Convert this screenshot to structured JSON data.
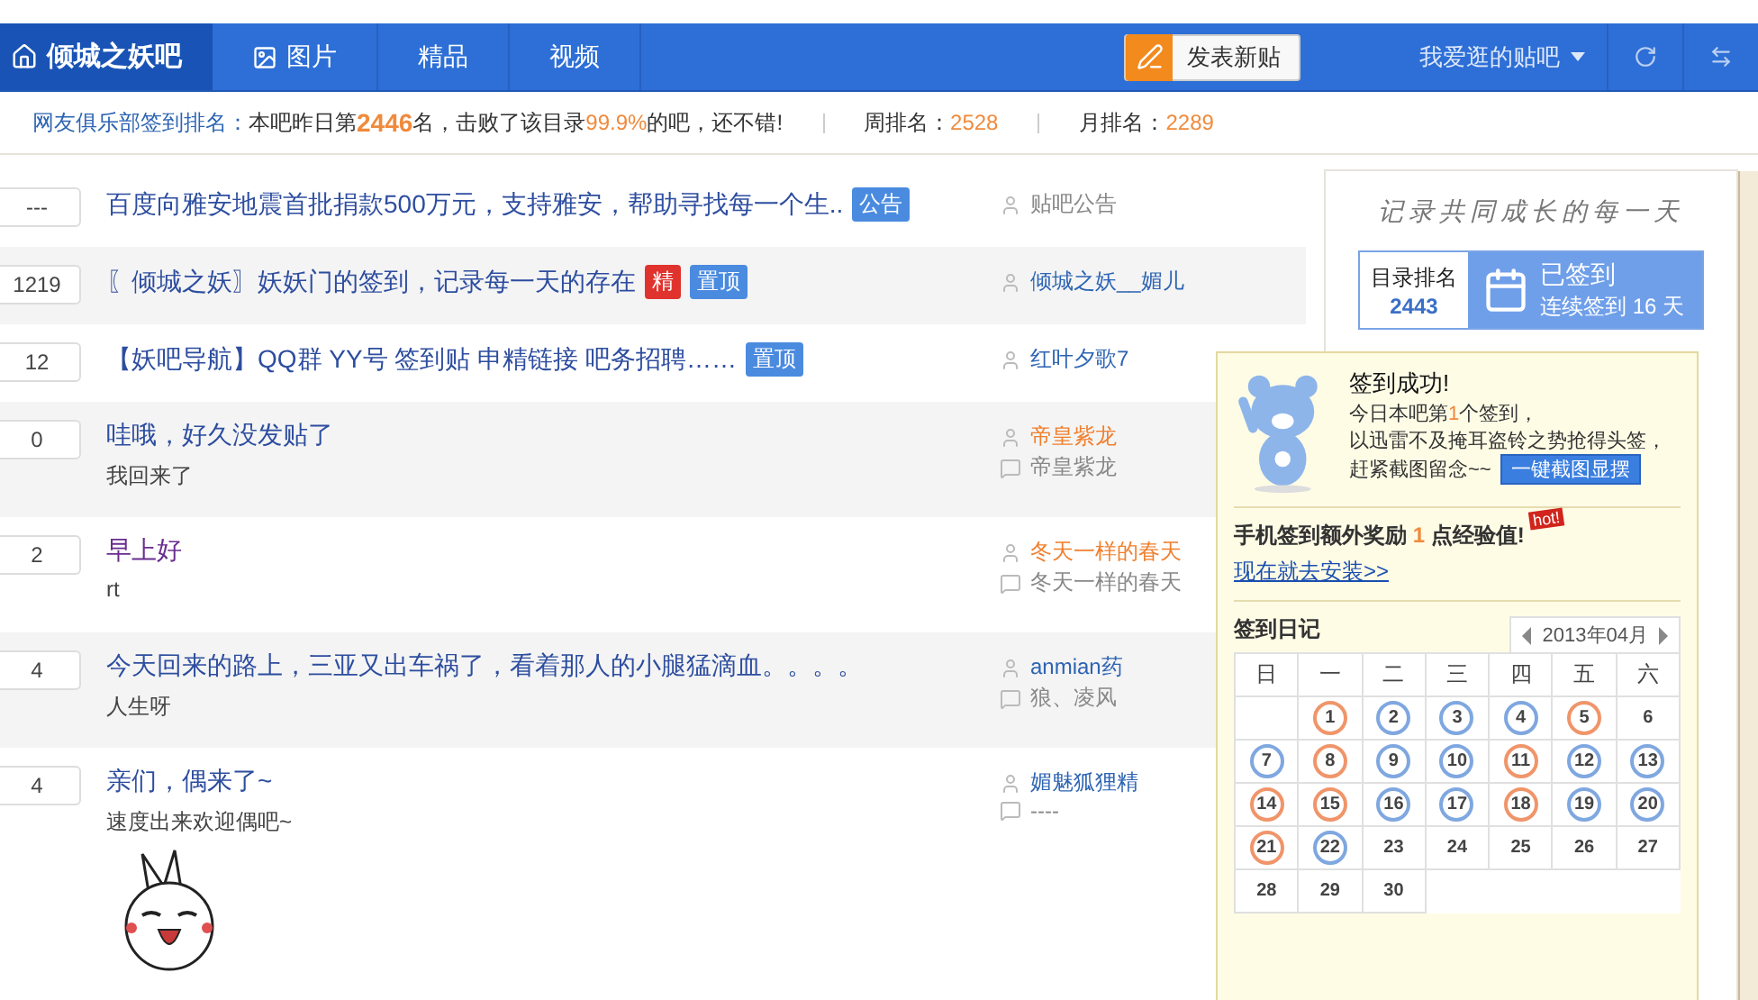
{
  "nav": {
    "forum_name": "倾城之妖吧",
    "tabs": [
      {
        "label": "图片",
        "selected": false,
        "kind": "image"
      },
      {
        "label": "精品",
        "selected": false,
        "kind": "plain"
      },
      {
        "label": "视频",
        "selected": false,
        "kind": "plain"
      }
    ],
    "publish_button": "发表新贴",
    "my_forums": "我爱逛的贴吧"
  },
  "rank_bar": {
    "label": "网友俱乐部签到排名：",
    "segments": [
      {
        "text": "本吧昨日第 ",
        "kind": "plain"
      },
      {
        "text": "2446",
        "kind": "strong"
      },
      {
        "text": " 名，击败了该目录 ",
        "kind": "plain"
      },
      {
        "text": "99.9%",
        "kind": "number"
      },
      {
        "text": " 的吧，还不错!",
        "kind": "plain"
      }
    ],
    "week_label": "周排名：",
    "week_rank": "2528",
    "month_label": "月排名：",
    "month_rank": "2289"
  },
  "posts": [
    {
      "replies": "---",
      "title": "百度向雅安地震首批捐款500万元，支持雅安，帮助寻找每一个生..",
      "visited": false,
      "tags": [
        {
          "text": "公告",
          "kind": "notice"
        }
      ],
      "author": "贴吧公告",
      "author_highlighted": false,
      "author_muted": true
    },
    {
      "replies": "1219",
      "title": "〖倾城之妖〗妖妖门的签到，记录每一天的存在",
      "visited": false,
      "tags": [
        {
          "text": "精",
          "kind": "featured"
        },
        {
          "text": "置顶",
          "kind": "top"
        }
      ],
      "author": "倾城之妖__媚儿",
      "author_highlighted": false,
      "author_muted": false
    },
    {
      "replies": "12",
      "title": "【妖吧导航】QQ群 YY号 签到贴 申精链接 吧务招聘……",
      "visited": false,
      "tags": [
        {
          "text": "置顶",
          "kind": "top"
        }
      ],
      "author": "红叶夕歌7",
      "author_highlighted": false,
      "author_muted": false
    },
    {
      "replies": "0",
      "title": "哇哦，好久没发贴了",
      "visited": false,
      "excerpt": "我回来了",
      "author": "帝皇紫龙",
      "author_highlighted": true,
      "author_muted": false,
      "last_reply": "帝皇紫龙"
    },
    {
      "replies": "2",
      "title": "早上好",
      "visited": true,
      "excerpt": "rt",
      "author": "冬天一样的春天",
      "author_highlighted": true,
      "author_muted": false,
      "last_reply": "冬天一样的春天"
    },
    {
      "replies": "4",
      "title": "今天回来的路上，三亚又出车祸了，看着那人的小腿猛滴血。。。。",
      "visited": false,
      "excerpt": "人生呀",
      "author": "anmian药",
      "author_highlighted": false,
      "author_muted": false,
      "last_reply": "狼、凌风"
    },
    {
      "replies": "4",
      "title": "亲们，偶来了~",
      "visited": false,
      "excerpt": "速度出来欢迎偶吧~",
      "has_image": true,
      "author": "媚魅狐狸精",
      "author_highlighted": false,
      "author_muted": false,
      "last_reply": "----"
    }
  ],
  "sidebar": {
    "slogan": "记录共同成长的每一天",
    "rank_label": "目录排名",
    "rank": "2443",
    "status": "已签到",
    "streak": "连续签到 16 天"
  },
  "popup": {
    "title": "签到成功!",
    "line1": [
      {
        "text": "今日本吧第",
        "kind": "plain"
      },
      {
        "text": "1",
        "kind": "number"
      },
      {
        "text": "个签到，",
        "kind": "plain"
      }
    ],
    "line2": "以迅雷不及掩耳盗铃之势抢得头签，",
    "line3": "赶紧截图留念~~",
    "share_button": "一键截图显摆",
    "mobile": [
      {
        "text": "手机签到额外奖励 ",
        "kind": "plain"
      },
      {
        "text": "1",
        "kind": "number"
      },
      {
        "text": " 点经验值!",
        "kind": "plain"
      }
    ],
    "hot_badge": "hot!",
    "install_link": "现在就去安装>>",
    "diary_title": "签到日记",
    "month": "2013年04月",
    "weekdays": [
      "日",
      "一",
      "二",
      "三",
      "四",
      "五",
      "六"
    ],
    "days": [
      {
        "kind": "blank"
      },
      {
        "kind": "day",
        "day": "1",
        "signed": true,
        "color": "#f0956a"
      },
      {
        "kind": "day",
        "day": "2",
        "signed": true,
        "color": "#7fa7e0"
      },
      {
        "kind": "day",
        "day": "3",
        "signed": true,
        "color": "#7fa7e0"
      },
      {
        "kind": "day",
        "day": "4",
        "signed": true,
        "color": "#7fa7e0"
      },
      {
        "kind": "day",
        "day": "5",
        "signed": true,
        "color": "#f0956a"
      },
      {
        "kind": "day",
        "day": "6",
        "signed": false
      },
      {
        "kind": "day",
        "day": "7",
        "signed": true,
        "color": "#7fa7e0"
      },
      {
        "kind": "day",
        "day": "8",
        "signed": true,
        "color": "#f0956a"
      },
      {
        "kind": "day",
        "day": "9",
        "signed": true,
        "color": "#7fa7e0"
      },
      {
        "kind": "day",
        "day": "10",
        "signed": true,
        "color": "#7fa7e0"
      },
      {
        "kind": "day",
        "day": "11",
        "signed": true,
        "color": "#f0956a"
      },
      {
        "kind": "day",
        "day": "12",
        "signed": true,
        "color": "#7fa7e0"
      },
      {
        "kind": "day",
        "day": "13",
        "signed": true,
        "color": "#7fa7e0"
      },
      {
        "kind": "day",
        "day": "14",
        "signed": true,
        "color": "#f0956a"
      },
      {
        "kind": "day",
        "day": "15",
        "signed": true,
        "color": "#f0956a"
      },
      {
        "kind": "day",
        "day": "16",
        "signed": true,
        "color": "#7fa7e0"
      },
      {
        "kind": "day",
        "day": "17",
        "signed": true,
        "color": "#7fa7e0"
      },
      {
        "kind": "day",
        "day": "18",
        "signed": true,
        "color": "#f0956a"
      },
      {
        "kind": "day",
        "day": "19",
        "signed": true,
        "color": "#7fa7e0"
      },
      {
        "kind": "day",
        "day": "20",
        "signed": true,
        "color": "#7fa7e0"
      },
      {
        "kind": "day",
        "day": "21",
        "signed": true,
        "color": "#f0956a"
      },
      {
        "kind": "day",
        "day": "22",
        "signed": true,
        "color": "#7fa7e0"
      },
      {
        "kind": "day",
        "day": "23",
        "signed": false
      },
      {
        "kind": "day",
        "day": "24",
        "signed": false
      },
      {
        "kind": "day",
        "day": "25",
        "signed": false
      },
      {
        "kind": "day",
        "day": "26",
        "signed": false
      },
      {
        "kind": "day",
        "day": "27",
        "signed": false
      },
      {
        "kind": "day",
        "day": "28",
        "signed": false
      },
      {
        "kind": "day",
        "day": "29",
        "signed": false
      },
      {
        "kind": "day",
        "day": "30",
        "signed": false
      }
    ]
  }
}
